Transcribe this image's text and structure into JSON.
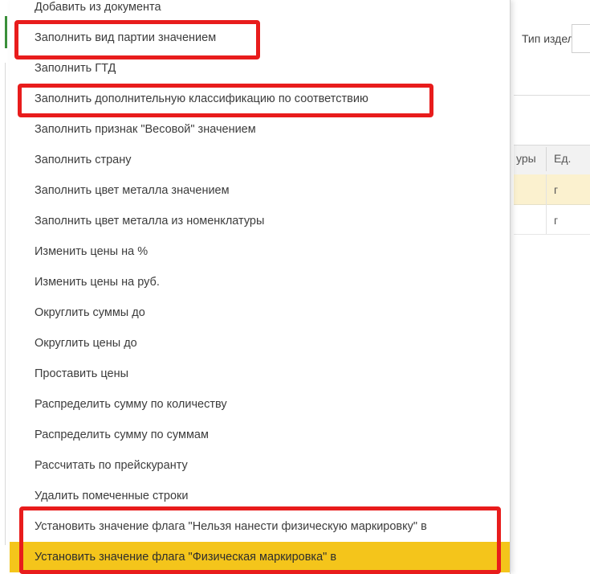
{
  "background": {
    "field_label": "Тип издел",
    "table": {
      "col1": "уры",
      "col2": "Ед.",
      "rows": [
        {
          "unit": "г",
          "selected": true
        },
        {
          "unit": "г",
          "selected": false
        }
      ]
    }
  },
  "menu": {
    "items": [
      {
        "label": "Добавить из документа"
      },
      {
        "label": "Заполнить вид партии значением",
        "outlined": true
      },
      {
        "label": "Заполнить ГТД"
      },
      {
        "label": "Заполнить дополнительную классификацию по соответствию",
        "outlined": true
      },
      {
        "label": "Заполнить признак \"Весовой\" значением"
      },
      {
        "label": "Заполнить страну"
      },
      {
        "label": "Заполнить цвет металла значением"
      },
      {
        "label": "Заполнить цвет металла из номенклатуры"
      },
      {
        "label": "Изменить цены на %"
      },
      {
        "label": "Изменить цены на руб."
      },
      {
        "label": "Округлить суммы до"
      },
      {
        "label": "Округлить цены до"
      },
      {
        "label": "Проставить цены"
      },
      {
        "label": "Распределить сумму по количеству"
      },
      {
        "label": "Распределить сумму по суммам"
      },
      {
        "label": "Рассчитать по прейскуранту"
      },
      {
        "label": "Удалить помеченные строки"
      },
      {
        "label": "Установить значение флага \"Нельзя нанести физическую маркировку\" в",
        "outlined": true
      },
      {
        "label": "Установить значение флага \"Физическая маркировка\" в",
        "outlined": true,
        "highlighted": true
      }
    ]
  },
  "colors": {
    "highlight": "#f4c51b",
    "outline": "#e81c1c",
    "selected_row": "#fbf1cf"
  }
}
